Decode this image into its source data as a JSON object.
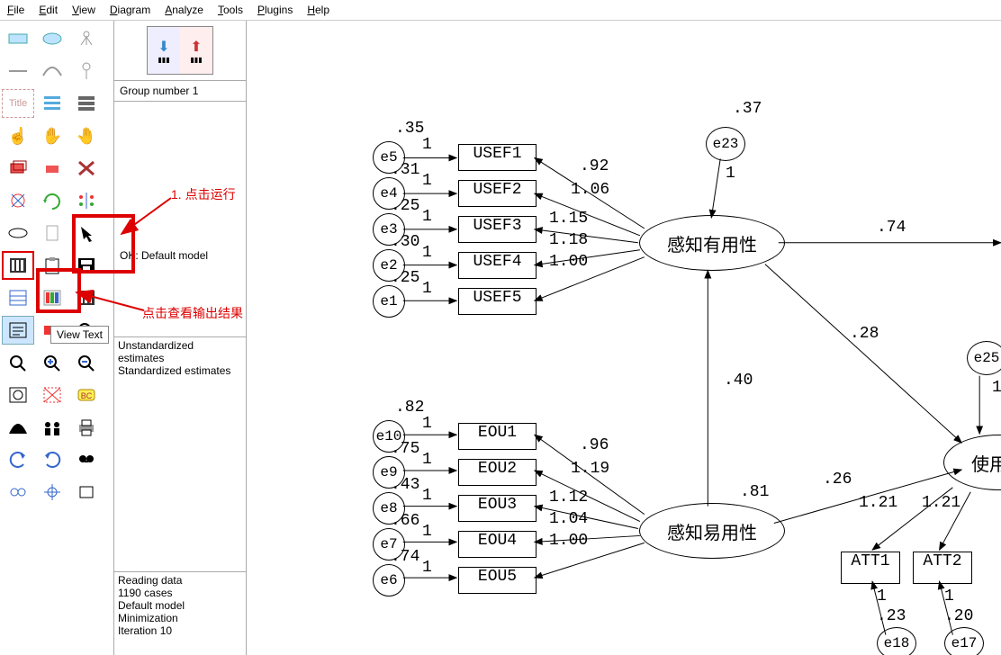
{
  "menu": {
    "file": "File",
    "edit": "Edit",
    "view": "View",
    "diagram": "Diagram",
    "analyze": "Analyze",
    "tools": "Tools",
    "plugins": "Plugins",
    "help": "Help"
  },
  "mid": {
    "group": "Group number 1",
    "model_status": "OK: Default model",
    "est1": "Unstandardized estimates",
    "est2": "Standardized estimates",
    "log": {
      "l1": "Reading data",
      "l2": "1190 cases",
      "l3": "Default model",
      "l4": "Minimization",
      "l5": "   Iteration 10"
    }
  },
  "tooltip": "View Text",
  "ann": {
    "a1": "1. 点击运行",
    "a2": "点击查看输出结果"
  },
  "boxes": {
    "u1": "USEF1",
    "u2": "USEF2",
    "u3": "USEF3",
    "u4": "USEF4",
    "u5": "USEF5",
    "e1": "EOU1",
    "e2": "EOU2",
    "e3": "EOU3",
    "e4": "EOU4",
    "e5": "EOU5",
    "a1": "ATT1",
    "a2": "ATT2"
  },
  "ovals": {
    "pu": "感知有用性",
    "peou": "感知易用性",
    "att": "使用态"
  },
  "errs": {
    "ue5": "e5",
    "ue4": "e4",
    "ue3": "e3",
    "ue2": "e2",
    "ue1": "e1",
    "ee10": "e10",
    "ee9": "e9",
    "ee8": "e8",
    "ee7": "e7",
    "ee6": "e6",
    "e23": "e23",
    "e25": "e25",
    "e18": "e18",
    "e17": "e17"
  },
  "vals": {
    "e23v": ".37",
    "e25one": "1",
    "u5v": ".35",
    "u4v": ".31",
    "u3v": ".25",
    "u2v": ".30",
    "u1v": ".25",
    "u5one": "1",
    "u4one": "1",
    "u3one": "1",
    "u2one": "1",
    "u1one": "1",
    "pu_u1": ".92",
    "pu_u2": "1.06",
    "pu_u3": "1.15",
    "pu_u4": "1.18",
    "pu_u5": "1.00",
    "ee10v": ".82",
    "ee9v": ".75",
    "ee8v": ".43",
    "ee7v": ".66",
    "ee6v": ".74",
    "ee10one": "1",
    "ee9one": "1",
    "ee8one": "1",
    "ee7one": "1",
    "ee6one": "1",
    "pe_e1": ".96",
    "pe_e2": "1.19",
    "pe_e3": "1.12",
    "pe_e4": "1.04",
    "pe_e5": "1.00",
    "pu_to_att_a": ".74",
    "pu_to_att_b": ".28",
    "peou_to_pu": ".40",
    "peou_coef": ".81",
    "peou_att": ".26",
    "att_a1": "1.21",
    "att_a2": "1.21",
    "e23one": "1",
    "e18v": ".23",
    "e17v": ".20",
    "e18one": "1",
    "e17one": "1"
  }
}
